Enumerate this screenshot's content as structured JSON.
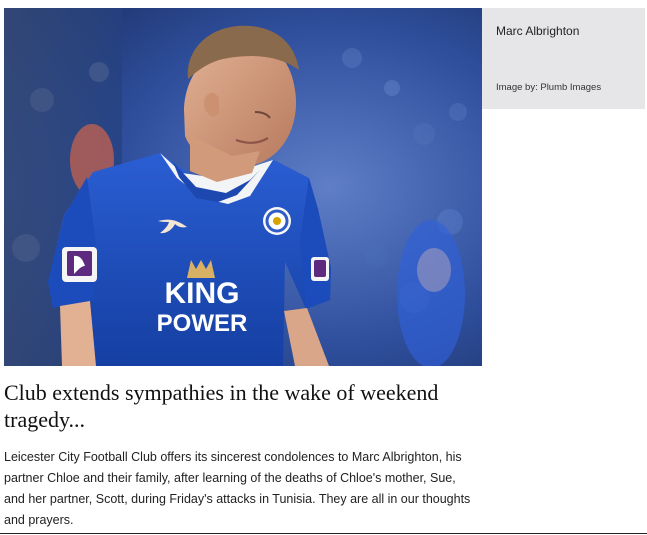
{
  "article": {
    "image_alt": "Marc Albrighton",
    "caption": {
      "title": "Marc Albrighton",
      "credit": "Image by: Plumb Images"
    },
    "headline": "Club extends sympathies in the wake of weekend tragedy...",
    "body": "Leicester City Football Club offers its sincerest condolences to Marc Albrighton, his partner Chloe and their family, after learning of the deaths of Chloe's mother, Sue, and her partner, Scott, during Friday's attacks in Tunisia. They are all in our thoughts and prayers.",
    "shirt_sponsor": "KING POWER",
    "colors": {
      "caption_bg": "#e6e6e8",
      "kit_blue": "#1f4fbf",
      "crowd_blue": "#3154a3"
    }
  }
}
